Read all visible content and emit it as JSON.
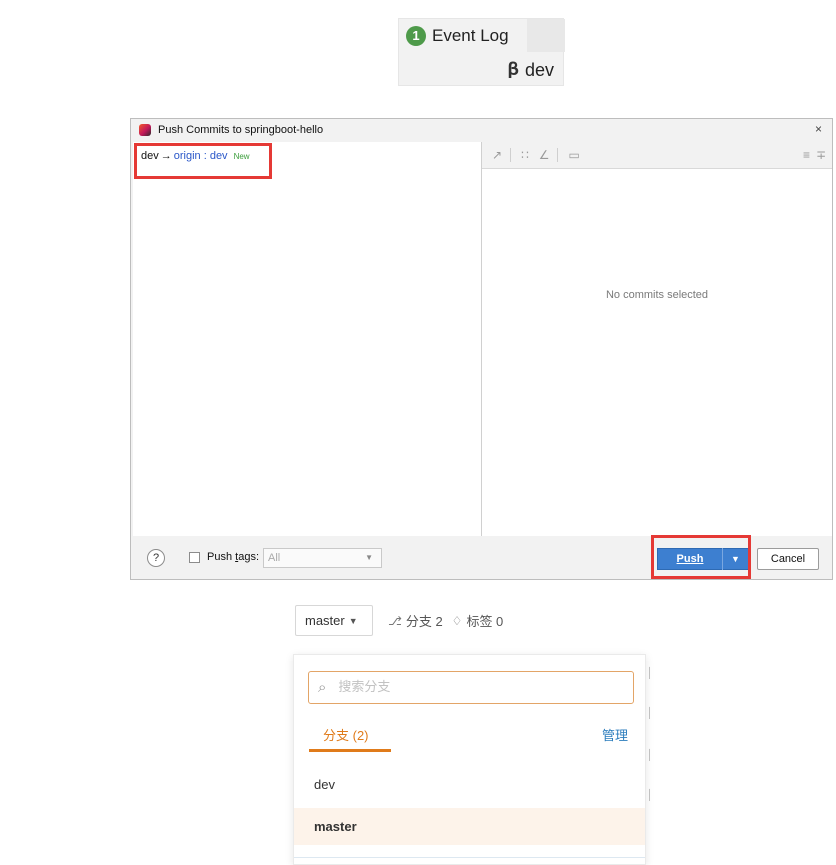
{
  "status_widget": {
    "event_log_count": "1",
    "event_log_label": "Event Log",
    "branch_label": "dev"
  },
  "push_dialog": {
    "title": "Push Commits to springboot-hello",
    "close_glyph": "×",
    "local_branch": "dev",
    "arrow": "→",
    "remote_branch": "origin : dev",
    "new_tag": "New",
    "empty_message": "No commits selected",
    "help_glyph": "?",
    "push_tags_prefix": "Push ",
    "push_tags_underlined": "t",
    "push_tags_suffix": "ags:",
    "push_tags_value": "All",
    "push_button": "Push",
    "cancel_button": "Cancel"
  },
  "gitee": {
    "branch_select": "master",
    "branches_stat": "分支 2",
    "tags_stat": "标签 0",
    "search_placeholder": "搜索分支",
    "tab_branches": "分支 (2)",
    "manage": "管理",
    "branches": [
      "dev",
      "master"
    ]
  },
  "colors": {
    "highlight": "#e53935",
    "push_button": "#3d7fd0",
    "gitee_accent": "#e07b1a",
    "link": "#2c7dbd",
    "new_tag": "#3a9d3a",
    "remote_branch": "#2a57c9"
  },
  "icons": {
    "event_log_badge": "green-circle-badge",
    "branch": "git-branch-icon",
    "search": "search-icon",
    "tag": "tag-icon"
  }
}
